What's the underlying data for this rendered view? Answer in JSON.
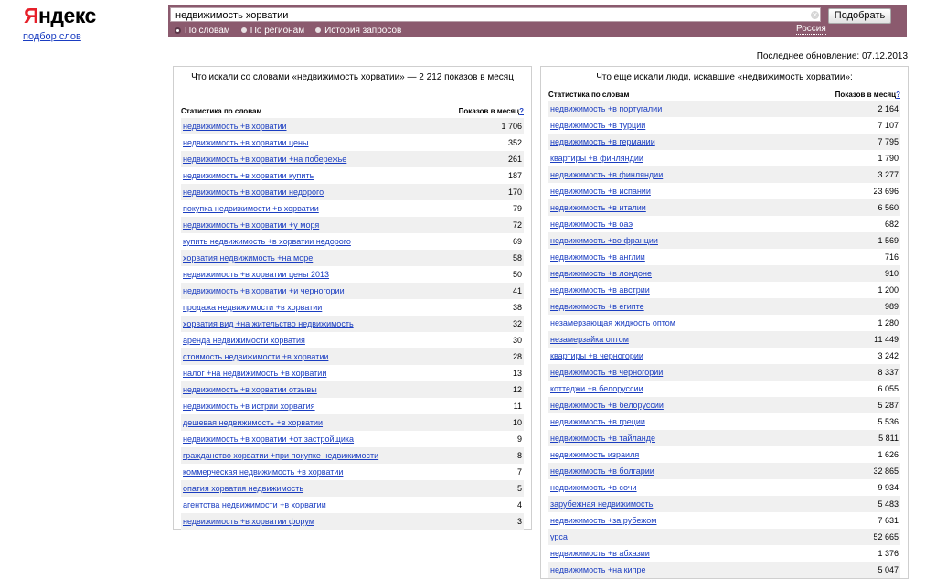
{
  "logo": {
    "first_letter": "Я",
    "rest": "ндекс"
  },
  "service_link": "подбор слов",
  "search": {
    "value": "недвижимость хорватии",
    "button": "Подобрать"
  },
  "modes": [
    {
      "label": "По словам",
      "selected": true
    },
    {
      "label": "По регионам",
      "selected": false
    },
    {
      "label": "История запросов",
      "selected": false
    }
  ],
  "region": "Россия",
  "last_update": "Последнее обновление: 07.12.2013",
  "left_panel": {
    "title": "Что искали со словами «недвижимость хорватии» — 2 212 показов в месяц",
    "col_keyword": "Статистика по словам",
    "col_count": "Показов в месяц",
    "help": "?",
    "rows": [
      {
        "kw": "недвижимость +в хорватии",
        "cnt": "1 706"
      },
      {
        "kw": "недвижимость +в хорватии цены",
        "cnt": "352"
      },
      {
        "kw": "недвижимость +в хорватии +на побережье",
        "cnt": "261"
      },
      {
        "kw": "недвижимость +в хорватии купить",
        "cnt": "187"
      },
      {
        "kw": "недвижимость +в хорватии недорого",
        "cnt": "170"
      },
      {
        "kw": "покупка недвижимости +в хорватии",
        "cnt": "79"
      },
      {
        "kw": "недвижимость +в хорватии +у моря",
        "cnt": "72"
      },
      {
        "kw": "купить недвижимость +в хорватии недорого",
        "cnt": "69"
      },
      {
        "kw": "хорватия недвижимость +на море",
        "cnt": "58"
      },
      {
        "kw": "недвижимость +в хорватии цены 2013",
        "cnt": "50"
      },
      {
        "kw": "недвижимость +в хорватии +и черногории",
        "cnt": "41"
      },
      {
        "kw": "продажа недвижимости +в хорватии",
        "cnt": "38"
      },
      {
        "kw": "хорватия вид +на жительство недвижимость",
        "cnt": "32"
      },
      {
        "kw": "аренда недвижимости хорватия",
        "cnt": "30"
      },
      {
        "kw": "стоимость недвижимости +в хорватии",
        "cnt": "28"
      },
      {
        "kw": "налог +на недвижимость +в хорватии",
        "cnt": "13"
      },
      {
        "kw": "недвижимость +в хорватии отзывы",
        "cnt": "12"
      },
      {
        "kw": "недвижимость +в истрии хорватия",
        "cnt": "11"
      },
      {
        "kw": "дешевая недвижимость +в хорватии",
        "cnt": "10"
      },
      {
        "kw": "недвижимость +в хорватии +от застройщика",
        "cnt": "9"
      },
      {
        "kw": "гражданство хорватии +при покупке недвижимости",
        "cnt": "8"
      },
      {
        "kw": "коммерческая недвижимость +в хорватии",
        "cnt": "7"
      },
      {
        "kw": "опатия хорватия недвижимость",
        "cnt": "5"
      },
      {
        "kw": "агентства недвижимости +в хорватии",
        "cnt": "4"
      },
      {
        "kw": "недвижимость +в хорватии форум",
        "cnt": "3"
      }
    ]
  },
  "right_panel": {
    "title": "Что еще искали люди, искавшие «недвижимость хорватии»:",
    "col_keyword": "Статистика по словам",
    "col_count": "Показов в месяц",
    "help": "?",
    "rows": [
      {
        "kw": "недвижимость +в португалии",
        "cnt": "2 164"
      },
      {
        "kw": "недвижимость +в турции",
        "cnt": "7 107"
      },
      {
        "kw": "недвижимость +в германии",
        "cnt": "7 795"
      },
      {
        "kw": "квартиры +в финляндии",
        "cnt": "1 790"
      },
      {
        "kw": "недвижимость +в финляндии",
        "cnt": "3 277"
      },
      {
        "kw": "недвижимость +в испании",
        "cnt": "23 696"
      },
      {
        "kw": "недвижимость +в италии",
        "cnt": "6 560"
      },
      {
        "kw": "недвижимость +в оаэ",
        "cnt": "682"
      },
      {
        "kw": "недвижимость +во франции",
        "cnt": "1 569"
      },
      {
        "kw": "недвижимость +в англии",
        "cnt": "716"
      },
      {
        "kw": "недвижимость +в лондоне",
        "cnt": "910"
      },
      {
        "kw": "недвижимость +в австрии",
        "cnt": "1 200"
      },
      {
        "kw": "недвижимость +в египте",
        "cnt": "989"
      },
      {
        "kw": "незамерзающая жидкость оптом",
        "cnt": "1 280"
      },
      {
        "kw": "незамерзайка оптом",
        "cnt": "11 449"
      },
      {
        "kw": "квартиры +в черногории",
        "cnt": "3 242"
      },
      {
        "kw": "недвижимость +в черногории",
        "cnt": "8 337"
      },
      {
        "kw": "коттеджи +в белоруссии",
        "cnt": "6 055"
      },
      {
        "kw": "недвижимость +в белоруссии",
        "cnt": "5 287"
      },
      {
        "kw": "недвижимость +в греции",
        "cnt": "5 536"
      },
      {
        "kw": "недвижимость +в тайланде",
        "cnt": "5 811"
      },
      {
        "kw": "недвижимость израиля",
        "cnt": "1 626"
      },
      {
        "kw": "недвижимость +в болгарии",
        "cnt": "32 865"
      },
      {
        "kw": "недвижимость +в сочи",
        "cnt": "9 934"
      },
      {
        "kw": "зарубежная недвижимость",
        "cnt": "5 483"
      },
      {
        "kw": "недвижимость +за рубежом",
        "cnt": "7 631"
      },
      {
        "kw": "урса",
        "cnt": "52 665"
      },
      {
        "kw": "недвижимость +в абхазии",
        "cnt": "1 376"
      },
      {
        "kw": "недвижимость +на кипре",
        "cnt": "5 047"
      }
    ]
  }
}
